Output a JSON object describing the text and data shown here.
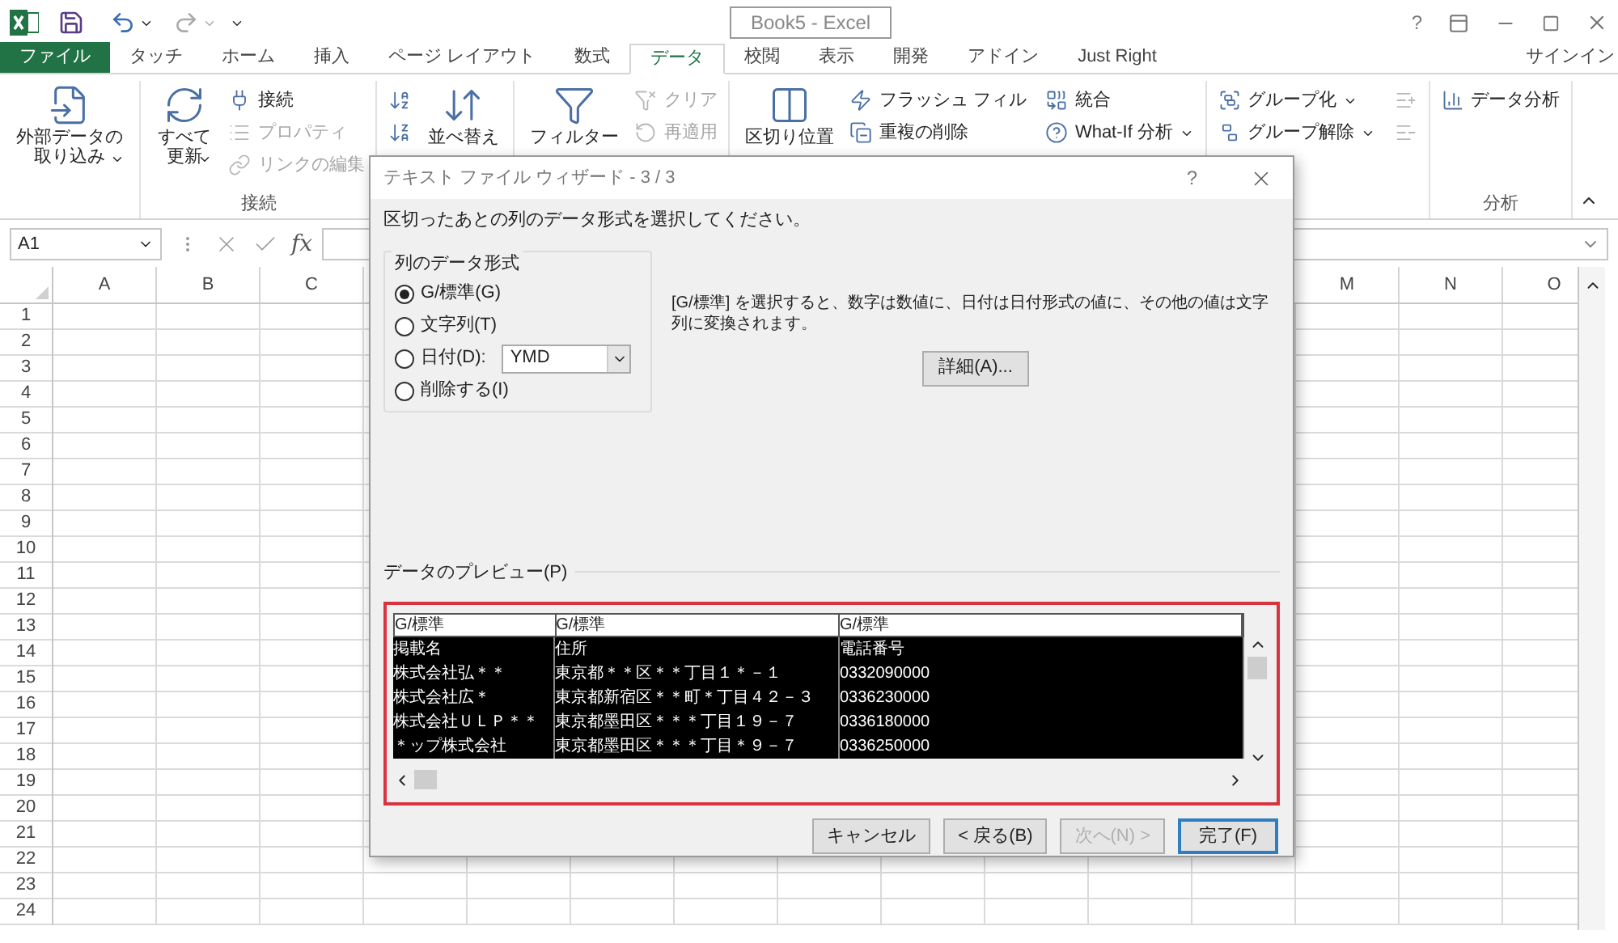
{
  "title_bar": {
    "title": "Book5 - Excel",
    "help": "?"
  },
  "ribbon_tabs": [
    {
      "label": "ファイル",
      "kind": "file",
      "selected": false
    },
    {
      "label": "タッチ",
      "kind": "tab",
      "selected": false
    },
    {
      "label": "ホーム",
      "kind": "tab",
      "selected": false
    },
    {
      "label": "挿入",
      "kind": "tab",
      "selected": false
    },
    {
      "label": "ページ レイアウト",
      "kind": "tab",
      "selected": false
    },
    {
      "label": "数式",
      "kind": "tab",
      "selected": false
    },
    {
      "label": "データ",
      "kind": "tab",
      "selected": true
    },
    {
      "label": "校閲",
      "kind": "tab",
      "selected": false
    },
    {
      "label": "表示",
      "kind": "tab",
      "selected": false
    },
    {
      "label": "開発",
      "kind": "tab",
      "selected": false
    },
    {
      "label": "アドイン",
      "kind": "tab",
      "selected": false
    },
    {
      "label": "Just Right",
      "kind": "tab",
      "selected": false
    }
  ],
  "account": "サインイン",
  "ribbon_groups": [
    {
      "items": [
        {
          "kind": "large",
          "label": "外部データの取り込み",
          "dropdown": true,
          "disabled": false
        }
      ]
    },
    {
      "label": "接続",
      "items": [
        {
          "kind": "large",
          "label": "すべて更新",
          "dropdown": true,
          "disabled": false
        },
        {
          "kind": "small",
          "label": "接続",
          "dropdown": false,
          "disabled": false
        },
        {
          "kind": "small",
          "label": "プロパティ",
          "dropdown": false,
          "disabled": true
        },
        {
          "kind": "small",
          "label": "リンクの編集",
          "dropdown": false,
          "disabled": true
        }
      ]
    },
    {
      "items": [
        {
          "kind": "icon",
          "disabled": false
        },
        {
          "kind": "icon",
          "disabled": false
        },
        {
          "kind": "large",
          "label": "並べ替え",
          "dropdown": false,
          "disabled": false
        }
      ]
    },
    {
      "items": [
        {
          "kind": "large",
          "label": "フィルター",
          "dropdown": false,
          "disabled": false
        },
        {
          "kind": "small",
          "label": "クリア",
          "dropdown": false,
          "disabled": true
        },
        {
          "kind": "small",
          "label": "再適用",
          "dropdown": false,
          "disabled": true
        }
      ]
    },
    {
      "items": [
        {
          "kind": "large",
          "label": "区切り位置",
          "dropdown": false,
          "disabled": false
        },
        {
          "kind": "small",
          "label": "フラッシュ フィル",
          "dropdown": false,
          "disabled": false
        },
        {
          "kind": "small",
          "label": "重複の削除",
          "dropdown": false,
          "disabled": false
        },
        {
          "kind": "small",
          "label": "統合",
          "dropdown": false,
          "disabled": false
        },
        {
          "kind": "small",
          "label": "What-If 分析",
          "dropdown": true,
          "disabled": false
        }
      ]
    },
    {
      "items": [
        {
          "kind": "small",
          "label": "グループ化",
          "dropdown": true,
          "disabled": false
        },
        {
          "kind": "small",
          "label": "グループ解除",
          "dropdown": true,
          "disabled": false
        },
        {
          "kind": "icon",
          "disabled": true
        },
        {
          "kind": "icon",
          "disabled": true
        }
      ]
    },
    {
      "label": "分析",
      "items": [
        {
          "kind": "small",
          "label": "データ分析",
          "dropdown": false,
          "disabled": false
        }
      ]
    }
  ],
  "formula_bar": {
    "name_box": "A1",
    "function_label": "fx"
  },
  "sheet": {
    "columns_left": [
      "A",
      "B",
      "C"
    ],
    "columns_right": [
      "M",
      "N",
      "O"
    ],
    "rows": [
      "1",
      "2",
      "3",
      "4",
      "5",
      "6",
      "7",
      "8",
      "9",
      "10",
      "11",
      "12",
      "13",
      "14",
      "15",
      "16",
      "17",
      "18",
      "19",
      "20",
      "21",
      "22",
      "23",
      "24"
    ]
  },
  "dialog": {
    "title": "テキスト ファイル ウィザード - 3 / 3",
    "help": "?",
    "instruction": "区切ったあとの列のデータ形式を選択してください。",
    "format_group": {
      "label": "列のデータ形式",
      "date_order": "YMD",
      "options": [
        {
          "label": "G/標準(G)",
          "kind": "plain",
          "selected": true
        },
        {
          "label": "文字列(T)",
          "kind": "plain",
          "selected": false
        },
        {
          "label": "日付(D):",
          "kind": "date",
          "selected": false
        },
        {
          "label": "削除する(I)",
          "kind": "plain",
          "selected": false
        }
      ]
    },
    "description": "[G/標準] を選択すると、数字は数値に、日付は日付形式の値に、その他の値は文字列に変換されます。",
    "advanced_button": "詳細(A)...",
    "preview": {
      "label": "データのプレビュー(P)",
      "columns": [
        "G/標準",
        "G/標準",
        "G/標準"
      ],
      "rows": [
        [
          "掲載名",
          "住所",
          "電話番号"
        ],
        [
          "株式会社弘＊＊",
          "東京都＊＊区＊＊丁目１＊－１",
          "0332090000"
        ],
        [
          "株式会社広＊",
          "東京都新宿区＊＊町＊丁目４２－３",
          "0336230000"
        ],
        [
          "株式会社ＵＬＰ＊＊",
          "東京都墨田区＊＊＊丁目１９－７",
          "0336180000"
        ],
        [
          "＊ップ株式会社",
          "東京都墨田区＊＊＊丁目＊９－７",
          "0336250000"
        ]
      ]
    },
    "buttons": [
      {
        "label": "キャンセル",
        "disabled": false,
        "default": false
      },
      {
        "label": "< 戻る(B)",
        "disabled": false,
        "default": false
      },
      {
        "label": "次へ(N) >",
        "disabled": true,
        "default": false
      },
      {
        "label": "完了(F)",
        "disabled": false,
        "default": true
      }
    ]
  }
}
